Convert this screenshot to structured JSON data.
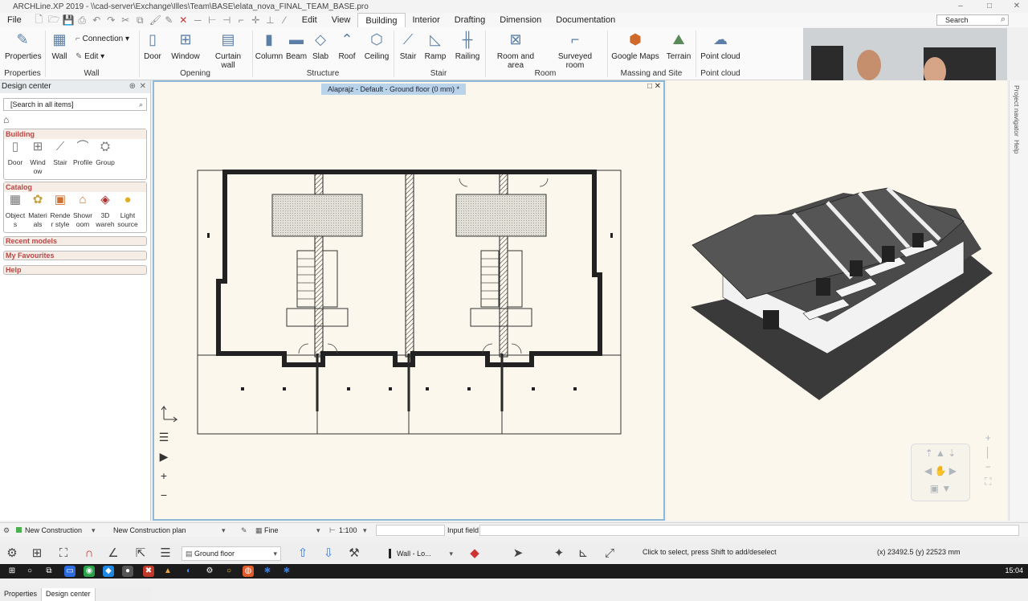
{
  "window": {
    "title": "ARCHLine.XP 2019 - \\\\cad-server\\Exchange\\Illes\\Team\\BASE\\elata_nova_FINAL_TEAM_BASE.pro"
  },
  "menu": {
    "file": "File",
    "edit": "Edit",
    "view": "View",
    "building": "Building",
    "interior": "Interior",
    "drafting": "Drafting",
    "dimension": "Dimension",
    "documentation": "Documentation",
    "search_placeholder": "Search"
  },
  "ribbon": {
    "properties": "Properties",
    "wall": "Wall",
    "connection": "Connection",
    "edit": "Edit",
    "door": "Door",
    "window": "Window",
    "curtain_wall": "Curtain wall",
    "column": "Column",
    "beam": "Beam",
    "slab": "Slab",
    "roof": "Roof",
    "ceiling": "Ceiling",
    "stair": "Stair",
    "ramp": "Ramp",
    "railing": "Railing",
    "room_and_area": "Room and area",
    "surveyed_room": "Surveyed room",
    "google_maps": "Google Maps",
    "terrain": "Terrain",
    "point_cloud": "Point cloud",
    "groups": {
      "properties": "Properties",
      "wall": "Wall",
      "opening": "Opening",
      "structure": "Structure",
      "stair": "Stair",
      "room": "Room",
      "massing": "Massing and Site",
      "point_cloud": "Point cloud"
    }
  },
  "design_center": {
    "title": "Design center",
    "search_placeholder": "[Search in all items]",
    "building": {
      "label": "Building",
      "items": [
        "Door",
        "Wind ow",
        "Stair",
        "Profile",
        "Group"
      ]
    },
    "catalog": {
      "label": "Catalog",
      "items": [
        "Object s",
        "Materi als",
        "Rende r style",
        "Showr oom",
        "3D wareh",
        "Light source"
      ]
    },
    "recent_models": "Recent models",
    "my_favourites": "My Favourites",
    "help": "Help",
    "tabs": {
      "properties": "Properties",
      "design_center": "Design center"
    }
  },
  "viewport": {
    "tab_title": "Alaprajz - Default - Ground floor (0 mm) *"
  },
  "right_rail": {
    "project_navigator": "Project navigator",
    "help": "Help"
  },
  "property_bar": {
    "construction": "New Construction",
    "plan": "New Construction plan",
    "fine": "Fine",
    "scale": "1:100",
    "input_field": "Input field"
  },
  "toolbar": {
    "floor": "Ground floor",
    "tool": "Wall - Lo...",
    "status": "Click to select, press Shift to add/deselect",
    "coords": "(x) 23492.5  (y) 22523 mm"
  },
  "taskbar": {
    "clock": "15:04"
  },
  "colors": {
    "accent": "#8fb9d9",
    "section_header": "#b44444",
    "canvas": "#fbf7ec"
  }
}
